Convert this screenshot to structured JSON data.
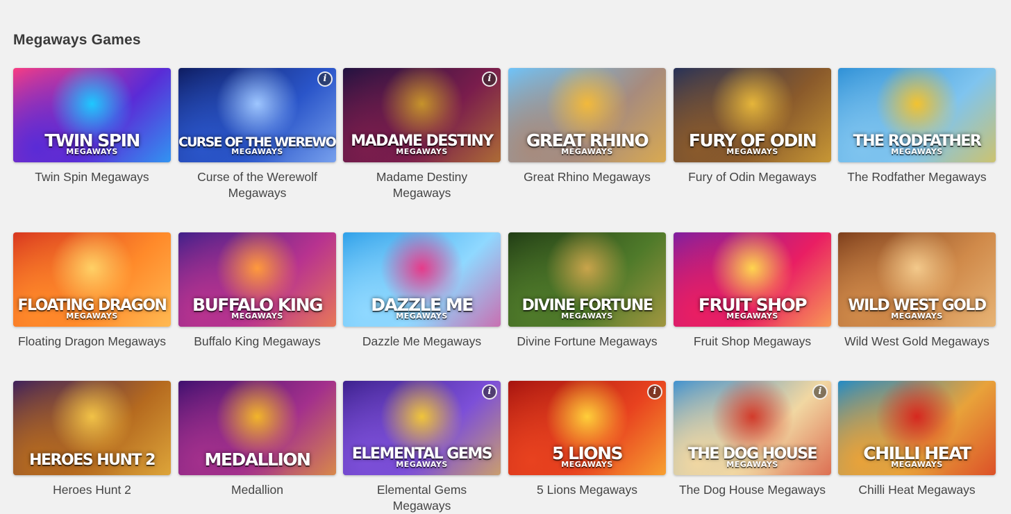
{
  "section": {
    "title": "Megaways Games"
  },
  "info_glyph": "i",
  "games": [
    {
      "name": "Twin Spin Megaways",
      "logo": "TWIN SPIN",
      "logo_sub": "MEGAWAYS",
      "info": false,
      "colors": [
        "#ff3d7f",
        "#5a2bd6",
        "#1ec8ff"
      ]
    },
    {
      "name": "Curse of the Werewolf Megaways",
      "logo": "CURSE OF THE WEREWOLF",
      "logo_sub": "MEGAWAYS",
      "info": true,
      "colors": [
        "#0d1a5c",
        "#2a55c9",
        "#9ec6ff"
      ]
    },
    {
      "name": "Madame Destiny Megaways",
      "logo": "MADAME DESTINY",
      "logo_sub": "MEGAWAYS",
      "info": true,
      "colors": [
        "#1d1240",
        "#7a1d4c",
        "#c6932b"
      ]
    },
    {
      "name": "Great Rhino Megaways",
      "logo": "GREAT RHINO",
      "logo_sub": "MEGAWAYS",
      "info": false,
      "colors": [
        "#6cc6ff",
        "#a78b7d",
        "#f2b93b"
      ]
    },
    {
      "name": "Fury of Odin Megaways",
      "logo": "FURY OF ODIN",
      "logo_sub": "MEGAWAYS",
      "info": false,
      "colors": [
        "#23305a",
        "#8a5a2b",
        "#e5b53a"
      ]
    },
    {
      "name": "The Rodfather Megaways",
      "logo": "THE RODFATHER",
      "logo_sub": "MEGAWAYS",
      "info": false,
      "colors": [
        "#2c8fd6",
        "#7fc4ef",
        "#f2c230"
      ]
    },
    {
      "name": "Floating Dragon Megaways",
      "logo": "FLOATING DRAGON",
      "logo_sub": "MEGAWAYS",
      "info": false,
      "colors": [
        "#d6331f",
        "#ff8a2a",
        "#ffd166"
      ]
    },
    {
      "name": "Buffalo King Megaways",
      "logo": "BUFFALO KING",
      "logo_sub": "MEGAWAYS",
      "info": false,
      "colors": [
        "#3b1f8a",
        "#b8338f",
        "#ff9a3c"
      ]
    },
    {
      "name": "Dazzle Me Megaways",
      "logo": "DAZZLE ME",
      "logo_sub": "MEGAWAYS",
      "info": false,
      "colors": [
        "#2b9ee8",
        "#8fd8ff",
        "#e53b8a"
      ]
    },
    {
      "name": "Divine Fortune Megaways",
      "logo": "DIVINE FORTUNE",
      "logo_sub": "MEGAWAYS",
      "info": false,
      "colors": [
        "#1f3a14",
        "#4f7a2a",
        "#c9a44b"
      ]
    },
    {
      "name": "Fruit Shop Megaways",
      "logo": "FRUIT SHOP",
      "logo_sub": "MEGAWAYS",
      "info": false,
      "colors": [
        "#7b1fa2",
        "#e91e63",
        "#ffd54f"
      ]
    },
    {
      "name": "Wild West Gold Megaways",
      "logo": "WILD WEST GOLD",
      "logo_sub": "MEGAWAYS",
      "info": false,
      "colors": [
        "#7a3b1a",
        "#d08a4a",
        "#f3c98b"
      ]
    },
    {
      "name": "Heroes Hunt 2",
      "logo": "HEROES HUNT 2",
      "logo_sub": "",
      "info": false,
      "colors": [
        "#3a1e5e",
        "#b56a1f",
        "#f1c247"
      ]
    },
    {
      "name": "Medallion",
      "logo": "MEDALLION",
      "logo_sub": "",
      "info": false,
      "colors": [
        "#3b0f6e",
        "#a3308c",
        "#f2b52a"
      ]
    },
    {
      "name": "Elemental Gems Megaways",
      "logo": "ELEMENTAL GEMS",
      "logo_sub": "MEGAWAYS",
      "info": true,
      "colors": [
        "#3a1f8a",
        "#7c4fd8",
        "#f0c53a"
      ]
    },
    {
      "name": "5 Lions Megaways",
      "logo": "5 LIONS",
      "logo_sub": "MEGAWAYS",
      "info": true,
      "colors": [
        "#a3120f",
        "#e8421f",
        "#ffcf3a"
      ]
    },
    {
      "name": "The Dog House Megaways",
      "logo": "THE DOG HOUSE",
      "logo_sub": "MEGAWAYS",
      "info": true,
      "colors": [
        "#3a8fd1",
        "#f1d7a2",
        "#d23b2b"
      ]
    },
    {
      "name": "Chilli Heat Megaways",
      "logo": "CHILLI HEAT",
      "logo_sub": "MEGAWAYS",
      "info": false,
      "colors": [
        "#1a8acb",
        "#e8a23a",
        "#d6281f"
      ]
    }
  ]
}
